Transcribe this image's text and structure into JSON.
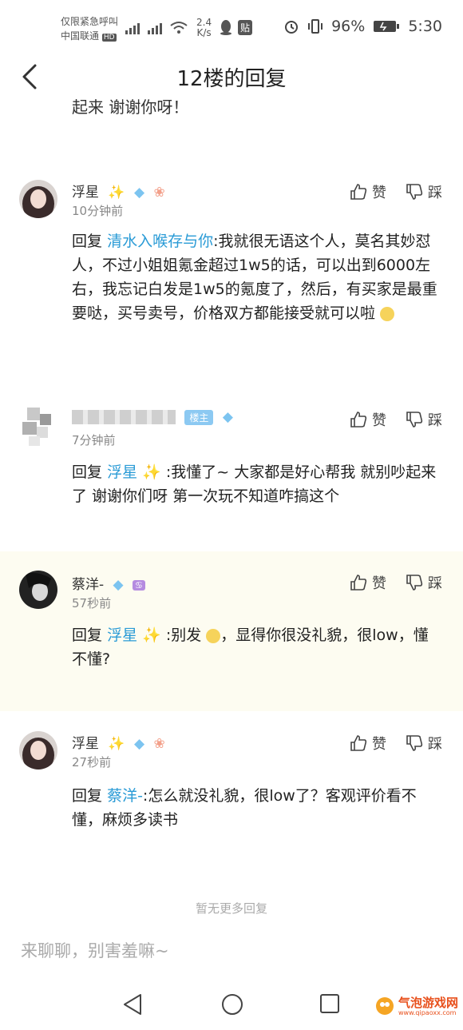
{
  "status_bar": {
    "emergency_text": "仅限紧急呼叫",
    "carrier": "中国联通",
    "hd": "HD",
    "network_speed": "2.4",
    "network_unit": "K/s",
    "battery": "96%",
    "time": "5:30",
    "tieba_icon": "贴"
  },
  "header": {
    "title": "12楼的回复"
  },
  "cut_off_text": "起来 谢谢你呀！",
  "replies": [
    {
      "name": "浮星",
      "time": "10分钟前",
      "reply_prefix": "回复",
      "mention": "清水入喉存与你",
      "text": ":我就很无语这个人，莫名其妙怼人，不过小姐姐氪金超过1w5的话，可以出到6000左右，我忘记白发是1w5的氪度了，然后，有买家是最重要哒，买号卖号，价格双方都能接受就可以啦",
      "like": "赞",
      "dislike": "踩"
    },
    {
      "name": "",
      "host_badge": "楼主",
      "time": "7分钟前",
      "reply_prefix": "回复",
      "mention": "浮星",
      "text": ":我懂了~ 大家都是好心帮我 就别吵起来了 谢谢你们呀 第一次玩不知道咋搞这个",
      "like": "赞",
      "dislike": "踩"
    },
    {
      "name": "蔡洋-",
      "time": "57秒前",
      "reply_prefix": "回复",
      "mention": "浮星",
      "text": ":别发",
      "text2": "，显得你很没礼貌，很low，懂不懂?",
      "like": "赞",
      "dislike": "踩"
    },
    {
      "name": "浮星",
      "time": "27秒前",
      "reply_prefix": "回复",
      "mention": "蔡洋-",
      "text": ":怎么就没礼貌，很low了？客观评价看不懂，麻烦多读书",
      "like": "赞",
      "dislike": "踩"
    }
  ],
  "no_more_text": "暂无更多回复",
  "input_placeholder": "来聊聊，别害羞嘛~",
  "watermark": {
    "text": "气泡游戏网",
    "sub": "www.qipaoxx.com"
  },
  "colors": {
    "mention": "#2a9bd6",
    "highlight_bg": "#fdfcf1",
    "muted": "#888888"
  }
}
